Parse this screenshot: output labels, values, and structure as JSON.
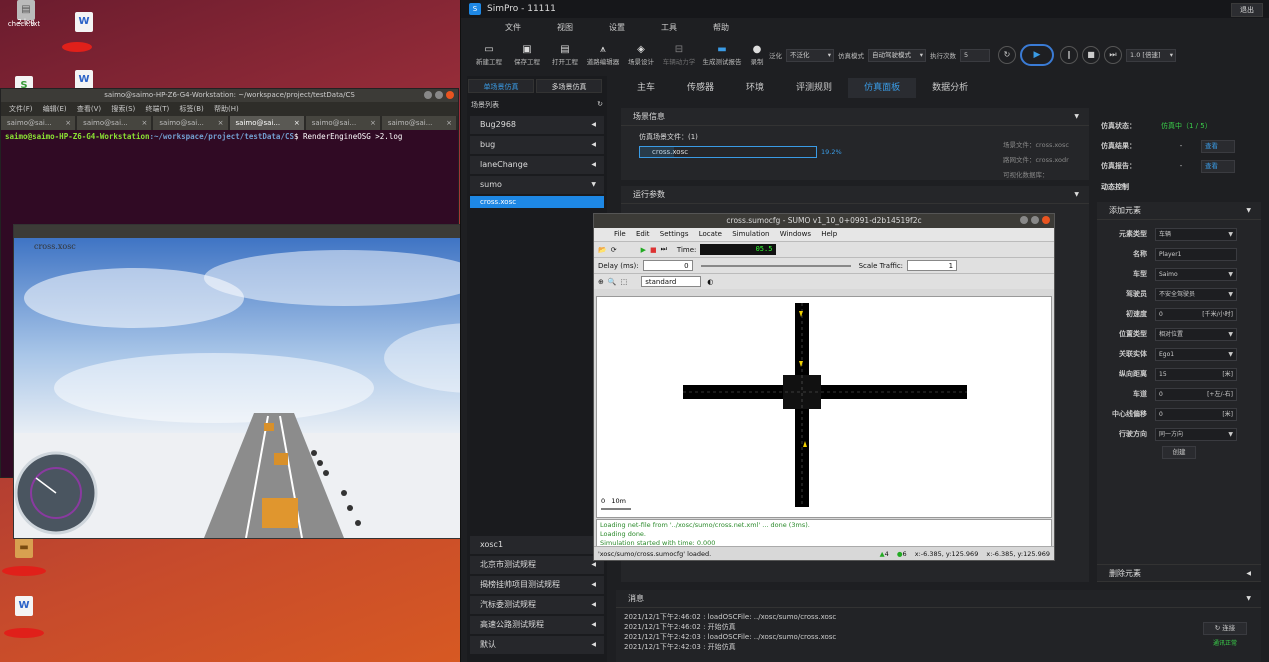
{
  "desktop": {
    "icons": [
      {
        "label": "2.log",
        "icon": "file-icon"
      },
      {
        "label": "check.txt",
        "icon": "file-icon"
      }
    ]
  },
  "terminal": {
    "title": "saimo@saimo-HP-Z6-G4-Workstation: ~/workspace/project/testData/CS",
    "menu": [
      "文件(F)",
      "编辑(E)",
      "查看(V)",
      "搜索(S)",
      "终端(T)",
      "标签(B)",
      "帮助(H)"
    ],
    "tabs": [
      "saimo@sai...",
      "saimo@sai...",
      "saimo@sai...",
      "saimo@sai...",
      "saimo@sai...",
      "saimo@sai..."
    ],
    "prompt_user": "saimo@saimo-HP-Z6-G4-Workstation",
    "prompt_path": ":~/workspace/project/testData/CS",
    "command": "$ RenderEngineOSG >2.log"
  },
  "osg": {
    "caption": "cross.xosc"
  },
  "simpro": {
    "app_title": "SimPro - 11111",
    "exit_label": "退出",
    "menu": [
      "文件",
      "视图",
      "设置",
      "工具",
      "帮助"
    ],
    "toolbar": {
      "new": "新建工程",
      "save": "保存工程",
      "open": "打开工程",
      "road_editor": "道路编辑器",
      "scene_design": "场景设计",
      "vehicle_dynamics": "车辆动力学",
      "gen_report": "生成测试报告",
      "record": "录制",
      "generalize": "泛化",
      "generalize_value": "不泛化",
      "sim_mode": "仿真模式",
      "sim_mode_value": "自动驾驶模式",
      "exec_count": "执行次数",
      "exec_count_value": "5",
      "speed_value": "1.0 [倍速]"
    },
    "left": {
      "single_btn": "单场景仿真",
      "multi_btn": "多场景仿真",
      "list_header": "场景列表",
      "items": [
        "Bug2968",
        "bug",
        "laneChange",
        "sumo"
      ],
      "selected_item": "cross.xosc",
      "bottom_items": [
        "xosc1",
        "北京市测试规程",
        "揭榜挂帅项目测试规程",
        "汽标委测试规程",
        "高速公路测试规程",
        "默认"
      ]
    },
    "tabs": [
      "主车",
      "传感器",
      "环境",
      "评测规则",
      "仿真面板",
      "数据分析"
    ],
    "scene_info": {
      "header": "场景信息",
      "files_label": "仿真场景文件：(1)",
      "file_name": "cross.xosc",
      "progress_text": "19.2%",
      "progress": 0.192,
      "scene_file_label": "场景文件：cross.xosc",
      "road_file_label": "路网文件：cross.xodr",
      "gen_db_label": "可视化数据库："
    },
    "run_params_header": "运行参数",
    "status": {
      "state_label": "仿真状态：",
      "state_value": "仿真中（1 / 5）",
      "result_label": "仿真结果：",
      "result_value": "-",
      "report_label": "仿真报告：",
      "report_value": "-",
      "view_label": "查看"
    },
    "dynamic_ctrl": "动态控制",
    "add_element": {
      "header": "添加元素",
      "rows": [
        {
          "k": "元素类型",
          "v": "车辆",
          "dd": true
        },
        {
          "k": "名称",
          "v": "Player1",
          "dd": false
        },
        {
          "k": "车型",
          "v": "Saimo",
          "dd": true
        },
        {
          "k": "驾驶员",
          "v": "不安全驾驶员",
          "dd": true
        },
        {
          "k": "初速度",
          "v": "0",
          "unit": "[千米/小时]"
        },
        {
          "k": "位置类型",
          "v": "相对位置",
          "dd": true
        },
        {
          "k": "关联实体",
          "v": "Ego1",
          "dd": true
        },
        {
          "k": "纵向距离",
          "v": "15",
          "unit": "[米]"
        },
        {
          "k": "车道",
          "v": "0",
          "unit": "[+左/-右]"
        },
        {
          "k": "中心线偏移",
          "v": "0",
          "unit": "[米]"
        },
        {
          "k": "行驶方向",
          "v": "同一方向",
          "dd": true
        }
      ],
      "create_btn": "创建",
      "delete_header": "删除元素"
    },
    "messages": {
      "header": "消息",
      "lines": [
        "2021/12/1下午2:46:02 : loadOSCFile: ../xosc/sumo/cross.xosc",
        "2021/12/1下午2:46:02 : 开始仿真",
        "2021/12/1下午2:42:03 : loadOSCFile: ../xosc/sumo/cross.xosc",
        "2021/12/1下午2:42:03 : 开始仿真"
      ],
      "connect_btn": "连接",
      "conn_status": "通讯正常"
    }
  },
  "sumo": {
    "title": "cross.sumocfg - SUMO v1_10_0+0991-d2b14519f2c",
    "menu": [
      "File",
      "Edit",
      "Settings",
      "Locate",
      "Simulation",
      "Windows",
      "Help"
    ],
    "time_label": "Time:",
    "time_value": "05.5",
    "delay_label": "Delay (ms):",
    "delay_value": "0",
    "scale_label": "Scale Traffic:",
    "scale_value": "1",
    "scheme": "standard",
    "scale_bar": "10m",
    "log": [
      "Loading net-file from '../xosc/sumo/cross.net.xml' ... done (3ms).",
      "Loading done.",
      "Simulation started with time: 0.000"
    ],
    "status": "'xosc/sumo/cross.sumocfg' loaded.",
    "count1": "4",
    "count2": "6",
    "coord1": "x:-6.385, y:125.969",
    "coord2": "x:-6.385, y:125.969"
  }
}
